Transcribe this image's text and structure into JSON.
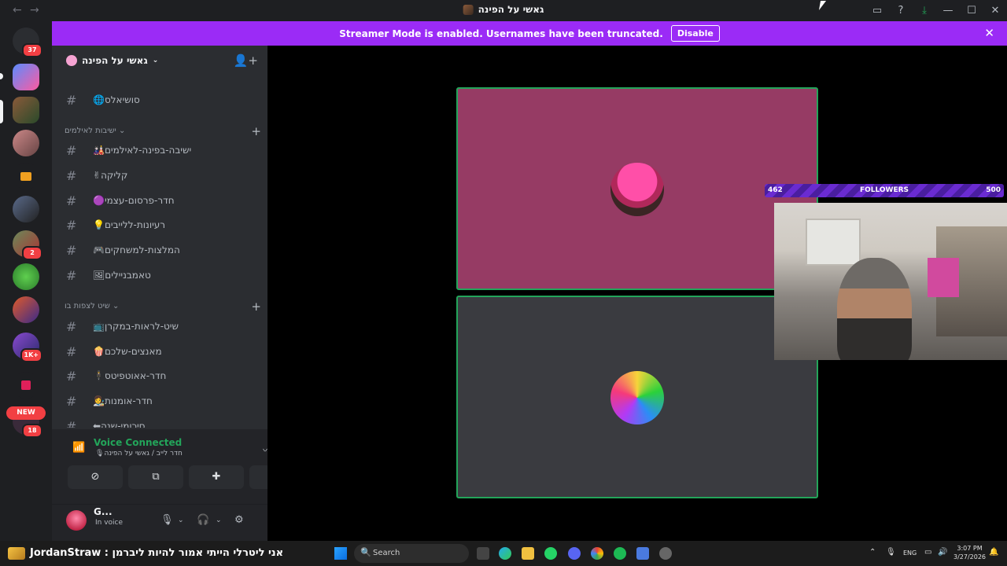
{
  "window": {
    "title": "גאשי על הפינה",
    "icons": [
      "inbox-icon",
      "help-icon",
      "download-icon",
      "minimize-icon",
      "maximize-icon",
      "close-icon"
    ]
  },
  "banner": {
    "text": "Streamer Mode is enabled. Usernames have been truncated.",
    "button": "Disable"
  },
  "guilds": {
    "home_badge": "37",
    "badges": [
      "2",
      "1K+",
      "18"
    ],
    "new_label": "NEW"
  },
  "server": {
    "name": "גאשי על הפינה"
  },
  "channels": {
    "top": [
      {
        "name": "🌐סושיאלס"
      }
    ],
    "category1": {
      "name": "ישיבות לאילמים",
      "items": [
        {
          "name": "🎎ישיבה-בפינה-לאילמים"
        },
        {
          "name": "✌קליקה"
        },
        {
          "name": "🟣חדר-פרסום-עצמי"
        },
        {
          "name": "💡רעיונות-ללייבים"
        },
        {
          "name": "🎮המלצות-למשחקים"
        },
        {
          "name": "🖼טאמבניילים"
        }
      ]
    },
    "category2": {
      "name": "שיט לצפות בו",
      "items": [
        {
          "name": "📺שיט-לראות-במקרן"
        },
        {
          "name": "🍿מאנצים-שלכם"
        },
        {
          "name": "🕴חדר-אאוטפיטס"
        },
        {
          "name": "👩‍🎨חדר-אומנות"
        },
        {
          "name": "⬅סיכומי-שנה"
        }
      ]
    }
  },
  "voice": {
    "status": "Voice Connected",
    "location": "🎙חדר לייב / גאשי על הפינה"
  },
  "user": {
    "name": "G...",
    "status": "In voice"
  },
  "stream_overlay": {
    "followers_current": "462",
    "followers_label": "FOLLOWERS",
    "followers_goal": "500"
  },
  "taskbar": {
    "ticker": "JordanStraw : אני ליטרלי הייתי אמור להיות ליברמן",
    "search_placeholder": "Search",
    "lang": "ENG",
    "time": "3:07 PM",
    "date": "3/27/2026"
  },
  "colors": {
    "banner": "#9b2bf6",
    "voice_green": "#23a55a",
    "tile1": "#963b64",
    "tile2": "#3a3b40"
  }
}
